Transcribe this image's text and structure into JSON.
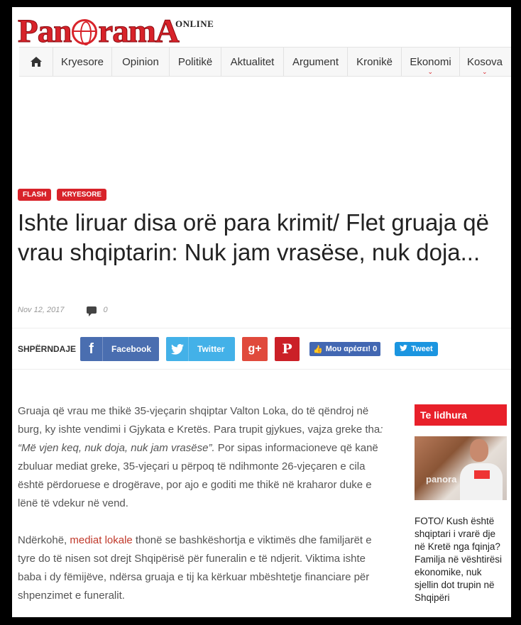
{
  "logo": {
    "online": "ONLINE",
    "part1": "Pan",
    "part2": "ram",
    "part3": "A"
  },
  "nav": {
    "items": [
      "Kryesore",
      "Opinion",
      "Politikë",
      "Aktualitet",
      "Argument",
      "Kronikë",
      "Ekonomi",
      "Kosova"
    ],
    "dropdown_marker": "⌄"
  },
  "article": {
    "badges": [
      "FLASH",
      "KRYESORE"
    ],
    "title": "Ishte liruar disa orë para krimit/ Flet gruaja që vrau shqiptarin: Nuk jam vrasëse, nuk doja...",
    "date": "Nov 12, 2017",
    "comments": "0",
    "p1_a": "Gruaja që vrau me thikë 35-vjeçarin shqiptar Valton Loka, do të qëndroj në burg, ky ishte vendimi i Gjykata e Kretës. Para trupit gjykues, vajza greke tha",
    "p1_quote": ": “Më vjen keq, nuk doja, nuk jam vrasëse”.",
    "p1_b": " Por sipas informacioneve që kanë zbuluar mediat greke, 35-vjeçari u përpoq të ndihmonte 26-vjeçaren e cila është përdoruese e drogërave, por ajo e goditi me thikë në kraharor duke e lënë të vdekur në vend.",
    "p2_a": "Ndërkohë, ",
    "p2_link": "mediat lokale",
    "p2_b": " thonë se bashkëshortja e viktimës dhe familjarët e tyre do të nisen sot drejt Shqipërisë për funeralin e të ndjerit. Viktima ishte baba i dy fëmijëve, ndërsa gruaja e tij ka kërkuar mbështetje financiare për shpenzimet e funeralit."
  },
  "share": {
    "label": "SHPËRNDAJE",
    "facebook": "Facebook",
    "twitter": "Twitter",
    "gplus": "g+",
    "pinterest": "P",
    "fb_like": "Μου αρέσει! 0",
    "tweet": "Tweet"
  },
  "sidebar": {
    "heading": "Te lidhura",
    "image_watermark": "panora",
    "caption": "FOTO/ Kush është shqiptari i vrarë dje në Kretë nga fqinja? Familja në vështirësi ekonomike, nuk sjellin dot trupin në Shqipëri"
  },
  "colors": {
    "brand_red": "#d8232a",
    "facebook": "#4a6eb0",
    "twitter": "#43b1e8",
    "gplus": "#e04a3c",
    "pinterest": "#cb2027"
  }
}
